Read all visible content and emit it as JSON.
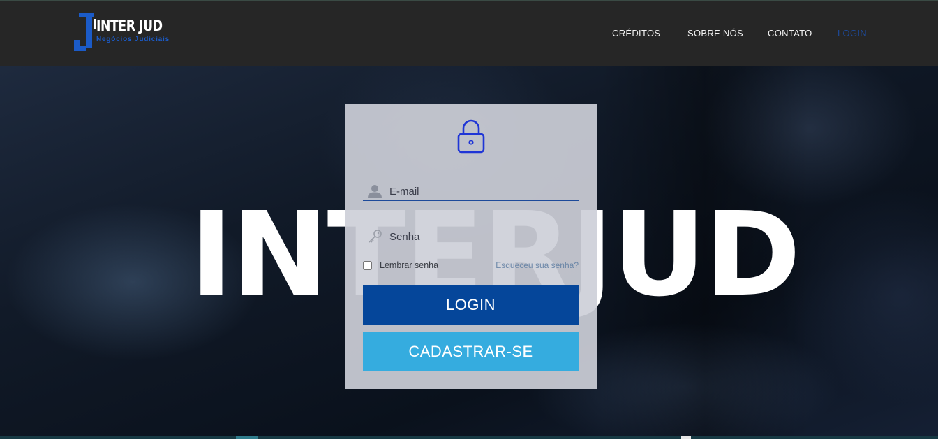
{
  "brand": {
    "name": "INTER JUD",
    "tagline": "Negócios Judiciais"
  },
  "nav": {
    "items": [
      {
        "label": "CRÉDITOS",
        "active": false
      },
      {
        "label": "SOBRE NÓS",
        "active": false
      },
      {
        "label": "CONTATO",
        "active": false
      },
      {
        "label": "LOGIN",
        "active": true
      }
    ]
  },
  "hero": {
    "title": "INTERJUD"
  },
  "login_form": {
    "lock_icon": "lock-icon",
    "email": {
      "placeholder": "E-mail",
      "value": "",
      "icon": "user-icon"
    },
    "password": {
      "placeholder": "Senha",
      "value": "",
      "icon": "key-icon"
    },
    "remember_label": "Lembrar senha",
    "remember_checked": false,
    "forgot_label": "Esqueceu sua senha?",
    "login_button": "LOGIN",
    "register_button": "CADASTRAR-SE"
  },
  "colors": {
    "navbar_bg": "#262626",
    "brand_blue": "#1b5bc8",
    "login_button": "#05469a",
    "register_button": "#35acdf",
    "active_nav": "#1d4a9a"
  }
}
